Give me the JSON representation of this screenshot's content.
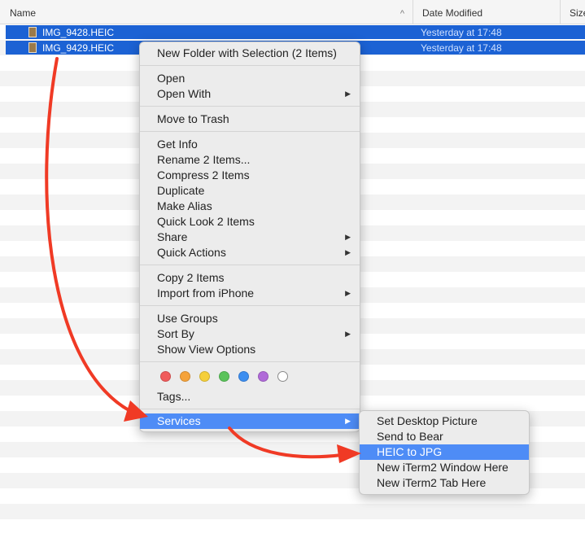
{
  "header": {
    "name": "Name",
    "date_modified": "Date Modified",
    "size": "Size"
  },
  "files": [
    {
      "name": "IMG_9428.HEIC",
      "date": "Yesterday at 17:48"
    },
    {
      "name": "IMG_9429.HEIC",
      "date": "Yesterday at 17:48"
    }
  ],
  "context_menu": {
    "new_folder": "New Folder with Selection (2 Items)",
    "open": "Open",
    "open_with": "Open With",
    "move_to_trash": "Move to Trash",
    "get_info": "Get Info",
    "rename": "Rename 2 Items...",
    "compress": "Compress 2 Items",
    "duplicate": "Duplicate",
    "make_alias": "Make Alias",
    "quick_look": "Quick Look 2 Items",
    "share": "Share",
    "quick_actions": "Quick Actions",
    "copy": "Copy 2 Items",
    "import_iphone": "Import from iPhone",
    "use_groups": "Use Groups",
    "sort_by": "Sort By",
    "show_view_options": "Show View Options",
    "tags": "Tags...",
    "services": "Services",
    "tag_colors": [
      "#f05b5b",
      "#f5a33b",
      "#f5cf3a",
      "#5ac35a",
      "#3c8ef0",
      "#b06ad8",
      "#ffffff"
    ]
  },
  "services_menu": {
    "set_desktop": "Set Desktop Picture",
    "send_to_bear": "Send to Bear",
    "heic_to_jpg": "HEIC to JPG",
    "iterm_window": "New iTerm2 Window Here",
    "iterm_tab": "New iTerm2 Tab Here"
  },
  "colors": {
    "selection": "#1c62d4",
    "menu_highlight": "#4e8cf6",
    "annotation_arrow": "#f03a25"
  }
}
